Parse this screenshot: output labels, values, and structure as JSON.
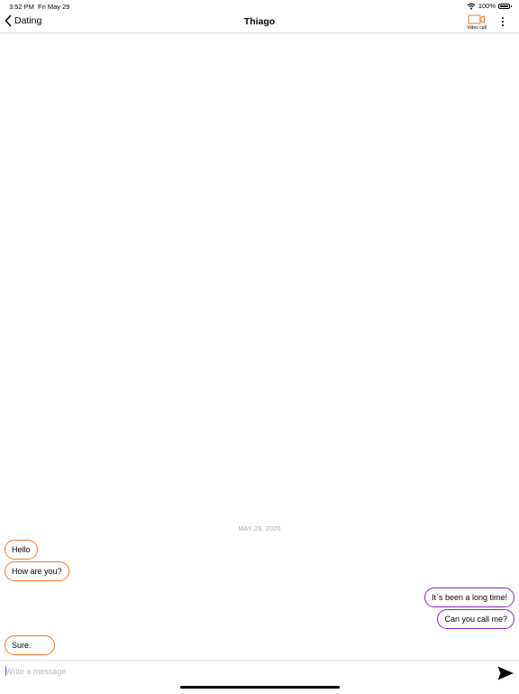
{
  "status_bar": {
    "time": "3:52 PM",
    "date": "Fri May 29",
    "battery": "100%"
  },
  "nav": {
    "back_label": "Dating",
    "title": "Thiago",
    "video_call_label": "Video call"
  },
  "conversation": {
    "date_separator": "MAY 29, 2020",
    "messages": [
      {
        "direction": "incoming",
        "text": "Hello"
      },
      {
        "direction": "incoming",
        "text": "How are you?"
      },
      {
        "direction": "outgoing",
        "text": "It`s been a long time!"
      },
      {
        "direction": "outgoing",
        "text": "Can you call me?"
      },
      {
        "direction": "incoming",
        "text": "Sure."
      }
    ]
  },
  "composer": {
    "placeholder": "Write a message",
    "value": ""
  },
  "colors": {
    "incoming_border": "#f07a2e",
    "outgoing_border": "#9123b8",
    "accent": "#f07a2e",
    "caret": "#3478f6"
  },
  "icons": {
    "back": "chevron-left-icon",
    "video_call": "video-camera-icon",
    "more": "vertical-ellipsis-icon",
    "send": "send-arrow-icon",
    "wifi": "wifi-icon",
    "battery": "battery-icon"
  }
}
